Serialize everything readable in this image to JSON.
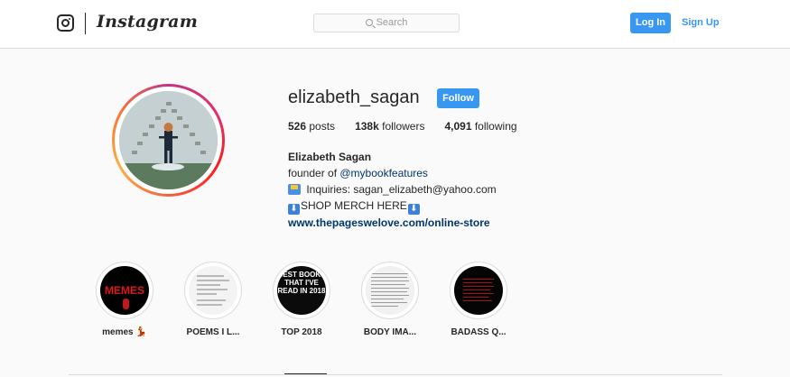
{
  "nav": {
    "wordmark": "Instagram",
    "search_placeholder": "Search",
    "login_label": "Log In",
    "signup_label": "Sign Up",
    "accent_color": "#3897f0"
  },
  "profile": {
    "username": "elizabeth_sagan",
    "follow_label": "Follow",
    "stats": {
      "posts_count": "526",
      "posts_label": "posts",
      "followers_count": "138k",
      "followers_label": "followers",
      "following_count": "4,091",
      "following_label": "following"
    },
    "bio": {
      "full_name": "Elizabeth Sagan",
      "line1_prefix": "founder of ",
      "line1_mention": "@mybookfeatures",
      "line2_icon": "inbox-tray-emoji",
      "line2_text": " Inquiries: sagan_elizabeth@yahoo.com",
      "line3_icon": "down-arrow-emoji",
      "line3_text": "SHOP MERCH HERE",
      "line3_arrow": "⬇",
      "website": "www.thepageswelove.com/online-store"
    }
  },
  "highlights": [
    {
      "label": "memes 💃",
      "cover_text": "MEMES"
    },
    {
      "label": "POEMS I L...",
      "cover_text": ""
    },
    {
      "label": "TOP 2018",
      "cover_text": "BEST BOOKS THAT I'VE READ IN 2018"
    },
    {
      "label": "BODY IMA...",
      "cover_text": ""
    },
    {
      "label": "BADASS Q...",
      "cover_text": ""
    }
  ]
}
